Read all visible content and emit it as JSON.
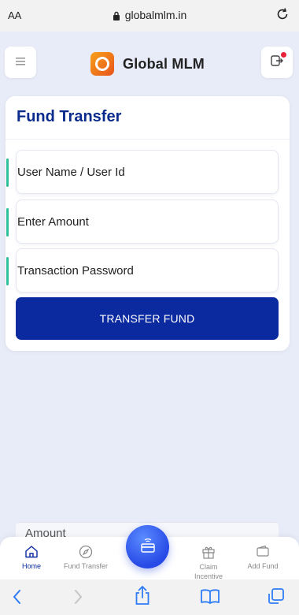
{
  "browser": {
    "text_size_label": "AA",
    "url": "globalmlm.in"
  },
  "header": {
    "brand_name": "Global MLM",
    "logo_text": "Global MLM"
  },
  "card": {
    "title": "Fund Transfer",
    "fields": [
      {
        "placeholder": "User Name / User Id",
        "value": ""
      },
      {
        "placeholder": "Enter Amount",
        "value": ""
      },
      {
        "placeholder": "Transaction Password",
        "value": ""
      }
    ],
    "submit_label": "TRANSFER FUND"
  },
  "background_peek": {
    "label": "Amount"
  },
  "bottom_nav": {
    "items": [
      {
        "label": "Home",
        "icon": "home-icon",
        "active": true
      },
      {
        "label": "Fund Transfer",
        "icon": "compass-icon",
        "active": false
      },
      {
        "label": "Claim Incentive",
        "icon": "gift-icon",
        "active": false
      },
      {
        "label": "Add Fund",
        "icon": "wallet-icon",
        "active": false
      }
    ],
    "center_button_icon": "wireless-card-icon"
  },
  "colors": {
    "accent": "#0b2aa0",
    "title": "#0b2b8c",
    "field_indicator": "#2fbf9a",
    "notification": "#e8213a",
    "logo_orange": "#f7a11a",
    "safari_blue": "#2f7cf6"
  }
}
